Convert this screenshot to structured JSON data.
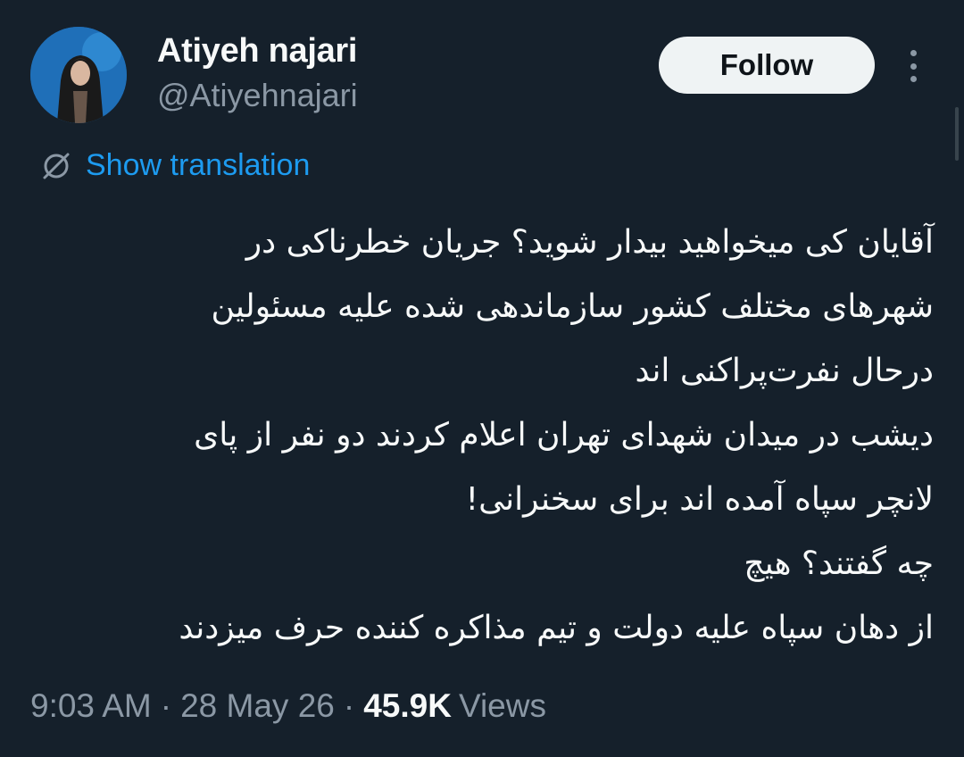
{
  "author": {
    "display_name": "Atiyeh najari",
    "handle": "@Atiyehnajari"
  },
  "actions": {
    "follow_label": "Follow",
    "more_icon": "more-vertical-icon"
  },
  "translation": {
    "icon": "globe-translate-icon",
    "label": "Show translation"
  },
  "tweet": {
    "lines": [
      "آقایان کی میخواهید بیدار شوید؟ جریان خطرناکی در",
      "شهرهای مختلف کشور سازماندهی شده علیه مسئولین",
      "درحال نفرت‌پراکنی اند",
      "دیشب در میدان شهدای تهران اعلام کردند دو نفر از پای",
      "لانچر سپاه آمده اند برای سخنرانی!",
      "چه گفتند؟ هیچ",
      "از دهان سپاه علیه دولت و تیم مذاکره کننده حرف میزدند"
    ]
  },
  "meta": {
    "time": "9:03 AM",
    "date": "28 May 26",
    "views_count": "45.9K",
    "views_label": "Views",
    "separator": "·"
  },
  "colors": {
    "background": "#15202b",
    "text_primary": "#f7f9f9",
    "text_secondary": "#8b98a5",
    "link": "#1d9bf0",
    "follow_button_bg": "#eff3f4"
  }
}
